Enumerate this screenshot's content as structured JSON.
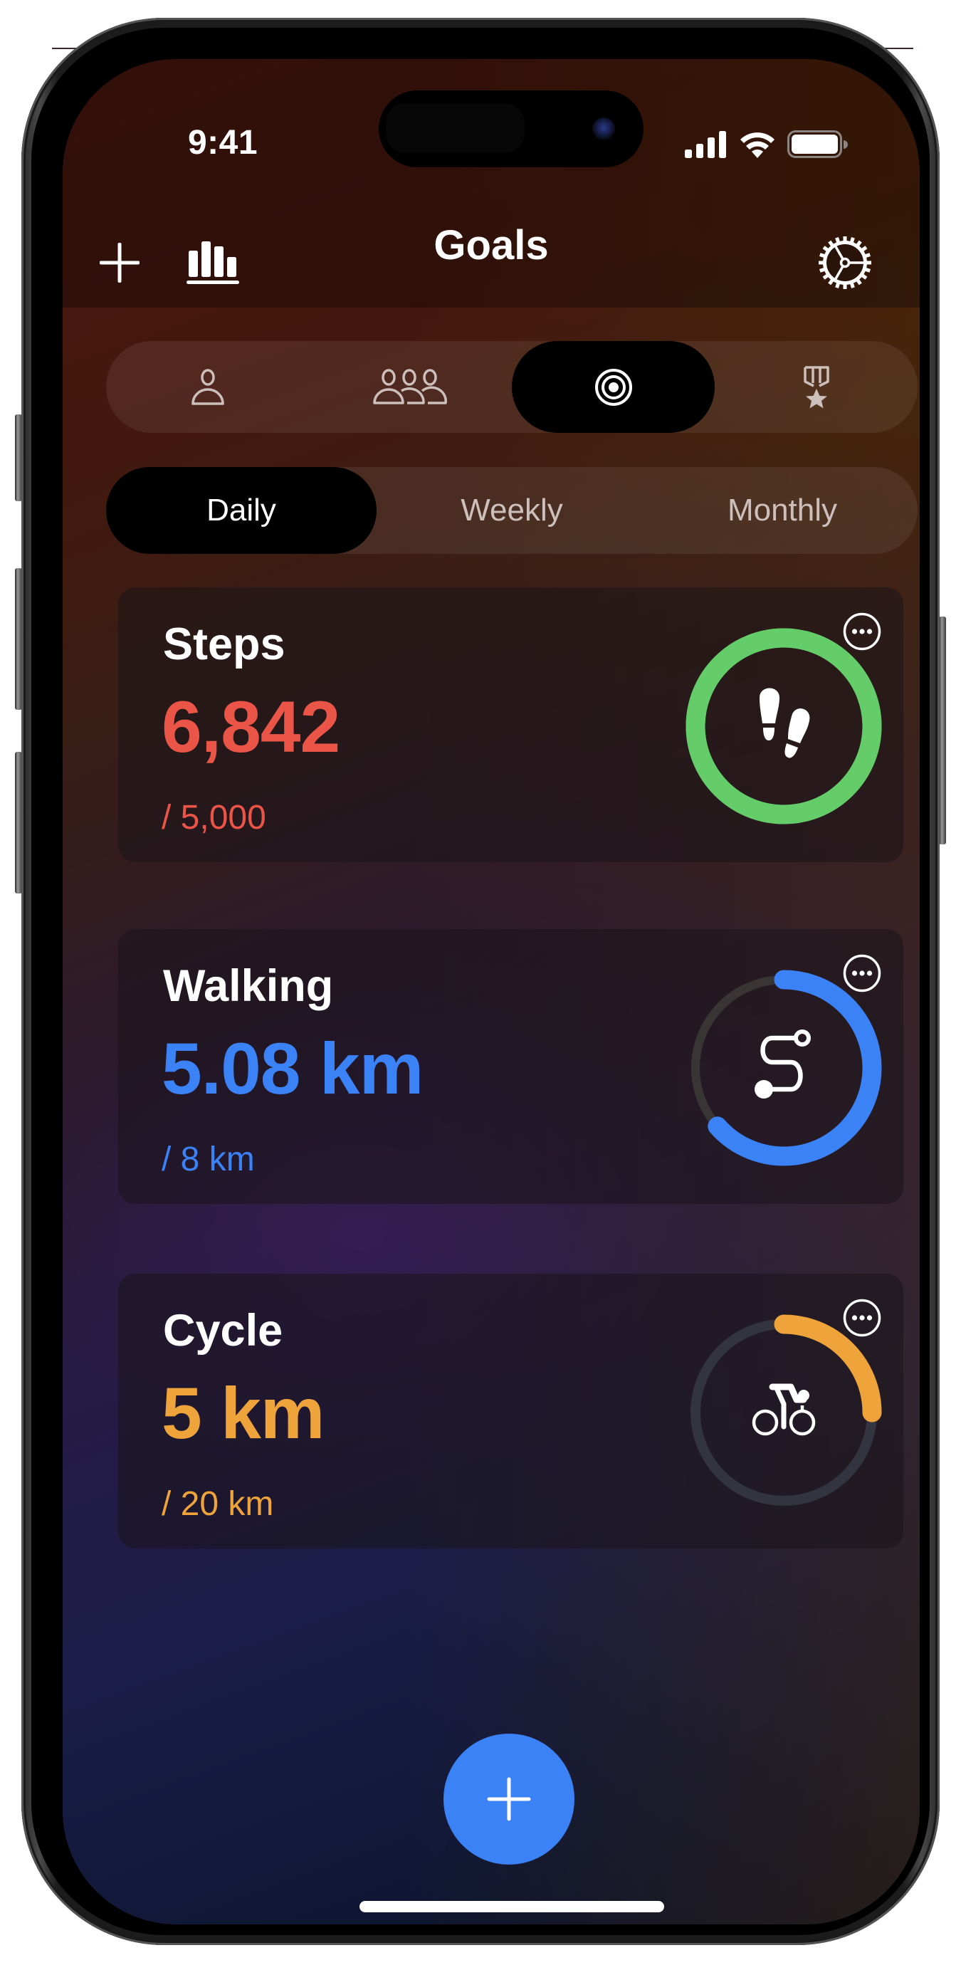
{
  "status_bar": {
    "time": "9:41",
    "icons": [
      "cellular-signal-icon",
      "wifi-icon",
      "battery-icon"
    ]
  },
  "header": {
    "title": "Goals",
    "left_buttons": [
      {
        "name": "add",
        "icon": "plus-icon"
      },
      {
        "name": "statistics",
        "icon": "bar-chart-icon"
      }
    ],
    "right_button": {
      "name": "settings",
      "icon": "gear-icon"
    }
  },
  "category_tabs": {
    "selected_index": 2,
    "items": [
      {
        "name": "personal",
        "icon": "person-icon"
      },
      {
        "name": "group",
        "icon": "group-icon"
      },
      {
        "name": "goals",
        "icon": "target-icon"
      },
      {
        "name": "achievements",
        "icon": "medal-star-icon"
      }
    ]
  },
  "period_tabs": {
    "selected_index": 0,
    "items": [
      "Daily",
      "Weekly",
      "Monthly"
    ]
  },
  "goals": [
    {
      "title": "Steps",
      "value": "6,842",
      "goal": "/ 5,000",
      "progress": 1.0,
      "color": "#ea5548",
      "ring_color": "#65cc6a",
      "track_color": "#65cc6a",
      "icon": "footprints-icon",
      "more_icon": "ellipsis-circle-icon"
    },
    {
      "title": "Walking",
      "value": "5.08 km",
      "goal": "/ 8 km",
      "progress": 0.635,
      "color": "#3b82f6",
      "ring_color": "#3b82f6",
      "track_color": "#3a3535",
      "icon": "route-icon",
      "more_icon": "ellipsis-circle-icon"
    },
    {
      "title": "Cycle",
      "value": "5 km",
      "goal": "/ 20 km",
      "progress": 0.25,
      "color": "#efa33b",
      "ring_color": "#efa33b",
      "track_color": "#32343f",
      "icon": "bicycle-icon",
      "more_icon": "ellipsis-circle-icon"
    }
  ],
  "fab": {
    "icon": "plus-icon",
    "color": "#3b82f6"
  }
}
